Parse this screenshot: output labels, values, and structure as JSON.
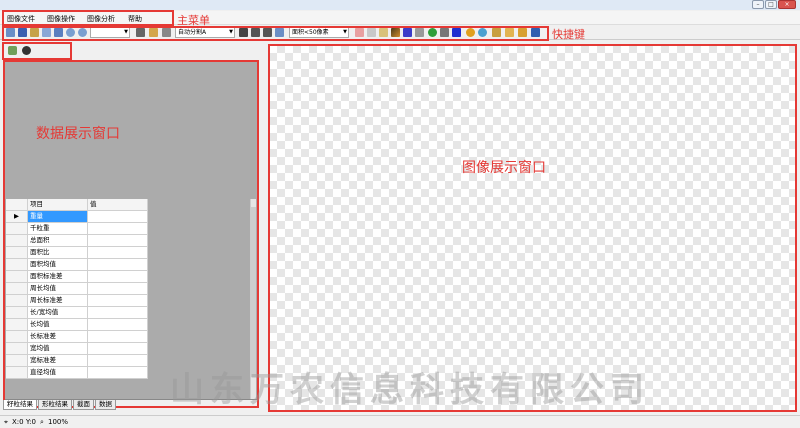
{
  "menu": {
    "items": [
      "图像文件",
      "图像操作",
      "图像分析",
      "帮助"
    ]
  },
  "toolbar": {
    "combo1": "",
    "combo2": "自动分割A",
    "combo3": "面积<50像素",
    "icons": [
      "new-icon",
      "save-icon",
      "open-icon",
      "copy-icon",
      "home-icon",
      "zoom-in-icon",
      "zoom-out-icon",
      "cut-icon",
      "ruler-icon",
      "tool-icon",
      "list-icon",
      "list2-icon",
      "tag-icon",
      "pin-icon",
      "grid-icon",
      "picture-icon",
      "gradient-icon",
      "palette-icon",
      "line-icon",
      "refresh-icon",
      "pointer-icon",
      "color-icon",
      "rotate-icon",
      "sync-icon",
      "folder-icon",
      "chart-icon",
      "tree-icon",
      "export-icon"
    ]
  },
  "annotations": {
    "main_menu": "主菜单",
    "shortcut": "快捷键",
    "data_window": "数据展示窗口",
    "image_window": "图像展示窗口"
  },
  "grid": {
    "headers": [
      "项目",
      "值"
    ],
    "rows": [
      "重量",
      "千粒重",
      "总面积",
      "面积比",
      "面积均值",
      "面积标准差",
      "周长均值",
      "周长标准差",
      "长/宽均值",
      "长均值",
      "长标准差",
      "宽均值",
      "宽标准差",
      "直径均值"
    ],
    "selected_index": 0
  },
  "tabs": [
    "籽粒结果",
    "形粒结果",
    "截面",
    "数据"
  ],
  "status": {
    "coords": "X:0 Y:0",
    "zoom": "100%"
  },
  "watermark": "山东万农信息科技有限公司",
  "window": {
    "minimize": "–",
    "maximize": "□",
    "close": "×"
  }
}
